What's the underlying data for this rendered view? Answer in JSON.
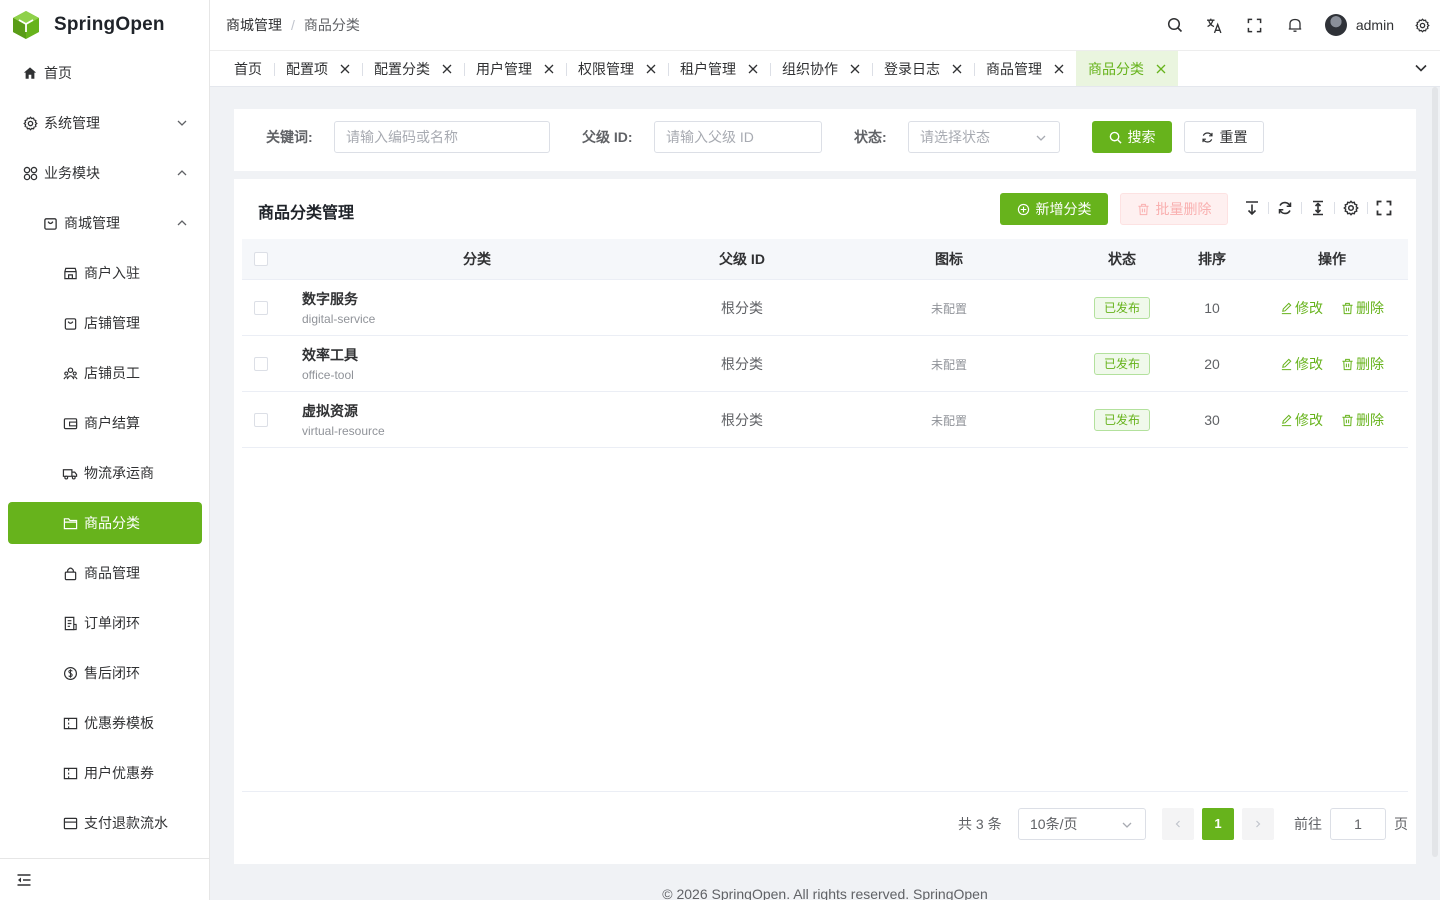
{
  "app": {
    "name": "SpringOpen"
  },
  "sidebar": {
    "items": [
      {
        "label": "首页",
        "icon": "home-icon"
      },
      {
        "label": "系统管理",
        "icon": "gear-icon"
      },
      {
        "label": "业务模块",
        "icon": "grid-icon"
      },
      {
        "label": "商城管理",
        "icon": "shop-bag-icon"
      },
      {
        "label": "商户入驻",
        "icon": "store-icon"
      },
      {
        "label": "店铺管理",
        "icon": "bag-icon"
      },
      {
        "label": "店铺员工",
        "icon": "people-icon"
      },
      {
        "label": "商户结算",
        "icon": "wallet-icon"
      },
      {
        "label": "物流承运商",
        "icon": "truck-icon"
      },
      {
        "label": "商品分类",
        "icon": "folder-icon"
      },
      {
        "label": "商品管理",
        "icon": "lock-bag-icon"
      },
      {
        "label": "订单闭环",
        "icon": "order-icon"
      },
      {
        "label": "售后闭环",
        "icon": "refund-icon"
      },
      {
        "label": "优惠券模板",
        "icon": "ticket-icon"
      },
      {
        "label": "用户优惠券",
        "icon": "ticket-icon"
      },
      {
        "label": "支付退款流水",
        "icon": "card-icon"
      }
    ]
  },
  "header": {
    "breadcrumb": [
      "商城管理",
      "商品分类"
    ],
    "breadcrumb_sep": "/",
    "user_name": "admin"
  },
  "tabs": [
    {
      "label": "首页",
      "closable": false
    },
    {
      "label": "配置项",
      "closable": true
    },
    {
      "label": "配置分类",
      "closable": true
    },
    {
      "label": "用户管理",
      "closable": true
    },
    {
      "label": "权限管理",
      "closable": true
    },
    {
      "label": "租户管理",
      "closable": true
    },
    {
      "label": "组织协作",
      "closable": true
    },
    {
      "label": "登录日志",
      "closable": true
    },
    {
      "label": "商品管理",
      "closable": true
    },
    {
      "label": "商品分类",
      "closable": true,
      "active": true
    }
  ],
  "search": {
    "keyword_label": "关键词:",
    "keyword_placeholder": "请输入编码或名称",
    "parent_label": "父级 ID:",
    "parent_placeholder": "请输入父级 ID",
    "status_label": "状态:",
    "status_placeholder": "请选择状态",
    "search_button": "搜索",
    "reset_button": "重置"
  },
  "table": {
    "title": "商品分类管理",
    "add_button": "新增分类",
    "batch_delete_button": "批量删除",
    "columns": [
      "分类",
      "父级 ID",
      "图标",
      "状态",
      "排序",
      "操作"
    ],
    "rows": [
      {
        "name": "数字服务",
        "code": "digital-service",
        "parent": "根分类",
        "icon": "未配置",
        "status": "已发布",
        "sort": "10"
      },
      {
        "name": "效率工具",
        "code": "office-tool",
        "parent": "根分类",
        "icon": "未配置",
        "status": "已发布",
        "sort": "20"
      },
      {
        "name": "虚拟资源",
        "code": "virtual-resource",
        "parent": "根分类",
        "icon": "未配置",
        "status": "已发布",
        "sort": "30"
      }
    ],
    "edit_label": "修改",
    "delete_label": "删除"
  },
  "pagination": {
    "total_text": "共 3 条",
    "page_size": "10条/页",
    "current_page": "1",
    "goto_label": "前往",
    "goto_value": "1",
    "page_suffix": "页"
  },
  "footer": {
    "text": "© 2026 SpringOpen. All rights reserved. SpringOpen"
  },
  "colors": {
    "primary": "#67b31c",
    "danger": "#f56c6c"
  }
}
